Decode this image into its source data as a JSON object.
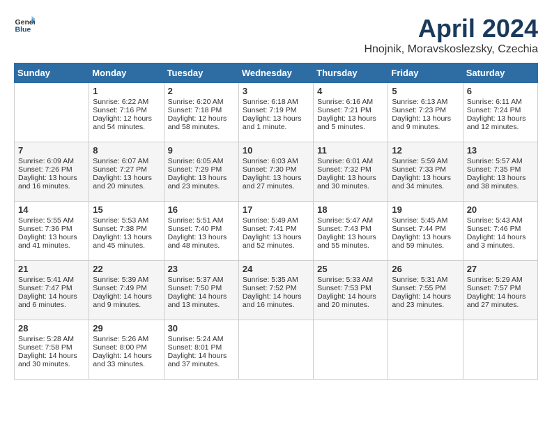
{
  "header": {
    "logo_general": "General",
    "logo_blue": "Blue",
    "title": "April 2024",
    "location": "Hnojnik, Moravskoslezsky, Czechia"
  },
  "weekdays": [
    "Sunday",
    "Monday",
    "Tuesday",
    "Wednesday",
    "Thursday",
    "Friday",
    "Saturday"
  ],
  "weeks": [
    [
      {
        "day": "",
        "content": ""
      },
      {
        "day": "1",
        "content": "Sunrise: 6:22 AM\nSunset: 7:16 PM\nDaylight: 12 hours\nand 54 minutes."
      },
      {
        "day": "2",
        "content": "Sunrise: 6:20 AM\nSunset: 7:18 PM\nDaylight: 12 hours\nand 58 minutes."
      },
      {
        "day": "3",
        "content": "Sunrise: 6:18 AM\nSunset: 7:19 PM\nDaylight: 13 hours\nand 1 minute."
      },
      {
        "day": "4",
        "content": "Sunrise: 6:16 AM\nSunset: 7:21 PM\nDaylight: 13 hours\nand 5 minutes."
      },
      {
        "day": "5",
        "content": "Sunrise: 6:13 AM\nSunset: 7:23 PM\nDaylight: 13 hours\nand 9 minutes."
      },
      {
        "day": "6",
        "content": "Sunrise: 6:11 AM\nSunset: 7:24 PM\nDaylight: 13 hours\nand 12 minutes."
      }
    ],
    [
      {
        "day": "7",
        "content": "Sunrise: 6:09 AM\nSunset: 7:26 PM\nDaylight: 13 hours\nand 16 minutes."
      },
      {
        "day": "8",
        "content": "Sunrise: 6:07 AM\nSunset: 7:27 PM\nDaylight: 13 hours\nand 20 minutes."
      },
      {
        "day": "9",
        "content": "Sunrise: 6:05 AM\nSunset: 7:29 PM\nDaylight: 13 hours\nand 23 minutes."
      },
      {
        "day": "10",
        "content": "Sunrise: 6:03 AM\nSunset: 7:30 PM\nDaylight: 13 hours\nand 27 minutes."
      },
      {
        "day": "11",
        "content": "Sunrise: 6:01 AM\nSunset: 7:32 PM\nDaylight: 13 hours\nand 30 minutes."
      },
      {
        "day": "12",
        "content": "Sunrise: 5:59 AM\nSunset: 7:33 PM\nDaylight: 13 hours\nand 34 minutes."
      },
      {
        "day": "13",
        "content": "Sunrise: 5:57 AM\nSunset: 7:35 PM\nDaylight: 13 hours\nand 38 minutes."
      }
    ],
    [
      {
        "day": "14",
        "content": "Sunrise: 5:55 AM\nSunset: 7:36 PM\nDaylight: 13 hours\nand 41 minutes."
      },
      {
        "day": "15",
        "content": "Sunrise: 5:53 AM\nSunset: 7:38 PM\nDaylight: 13 hours\nand 45 minutes."
      },
      {
        "day": "16",
        "content": "Sunrise: 5:51 AM\nSunset: 7:40 PM\nDaylight: 13 hours\nand 48 minutes."
      },
      {
        "day": "17",
        "content": "Sunrise: 5:49 AM\nSunset: 7:41 PM\nDaylight: 13 hours\nand 52 minutes."
      },
      {
        "day": "18",
        "content": "Sunrise: 5:47 AM\nSunset: 7:43 PM\nDaylight: 13 hours\nand 55 minutes."
      },
      {
        "day": "19",
        "content": "Sunrise: 5:45 AM\nSunset: 7:44 PM\nDaylight: 13 hours\nand 59 minutes."
      },
      {
        "day": "20",
        "content": "Sunrise: 5:43 AM\nSunset: 7:46 PM\nDaylight: 14 hours\nand 3 minutes."
      }
    ],
    [
      {
        "day": "21",
        "content": "Sunrise: 5:41 AM\nSunset: 7:47 PM\nDaylight: 14 hours\nand 6 minutes."
      },
      {
        "day": "22",
        "content": "Sunrise: 5:39 AM\nSunset: 7:49 PM\nDaylight: 14 hours\nand 9 minutes."
      },
      {
        "day": "23",
        "content": "Sunrise: 5:37 AM\nSunset: 7:50 PM\nDaylight: 14 hours\nand 13 minutes."
      },
      {
        "day": "24",
        "content": "Sunrise: 5:35 AM\nSunset: 7:52 PM\nDaylight: 14 hours\nand 16 minutes."
      },
      {
        "day": "25",
        "content": "Sunrise: 5:33 AM\nSunset: 7:53 PM\nDaylight: 14 hours\nand 20 minutes."
      },
      {
        "day": "26",
        "content": "Sunrise: 5:31 AM\nSunset: 7:55 PM\nDaylight: 14 hours\nand 23 minutes."
      },
      {
        "day": "27",
        "content": "Sunrise: 5:29 AM\nSunset: 7:57 PM\nDaylight: 14 hours\nand 27 minutes."
      }
    ],
    [
      {
        "day": "28",
        "content": "Sunrise: 5:28 AM\nSunset: 7:58 PM\nDaylight: 14 hours\nand 30 minutes."
      },
      {
        "day": "29",
        "content": "Sunrise: 5:26 AM\nSunset: 8:00 PM\nDaylight: 14 hours\nand 33 minutes."
      },
      {
        "day": "30",
        "content": "Sunrise: 5:24 AM\nSunset: 8:01 PM\nDaylight: 14 hours\nand 37 minutes."
      },
      {
        "day": "",
        "content": ""
      },
      {
        "day": "",
        "content": ""
      },
      {
        "day": "",
        "content": ""
      },
      {
        "day": "",
        "content": ""
      }
    ]
  ]
}
